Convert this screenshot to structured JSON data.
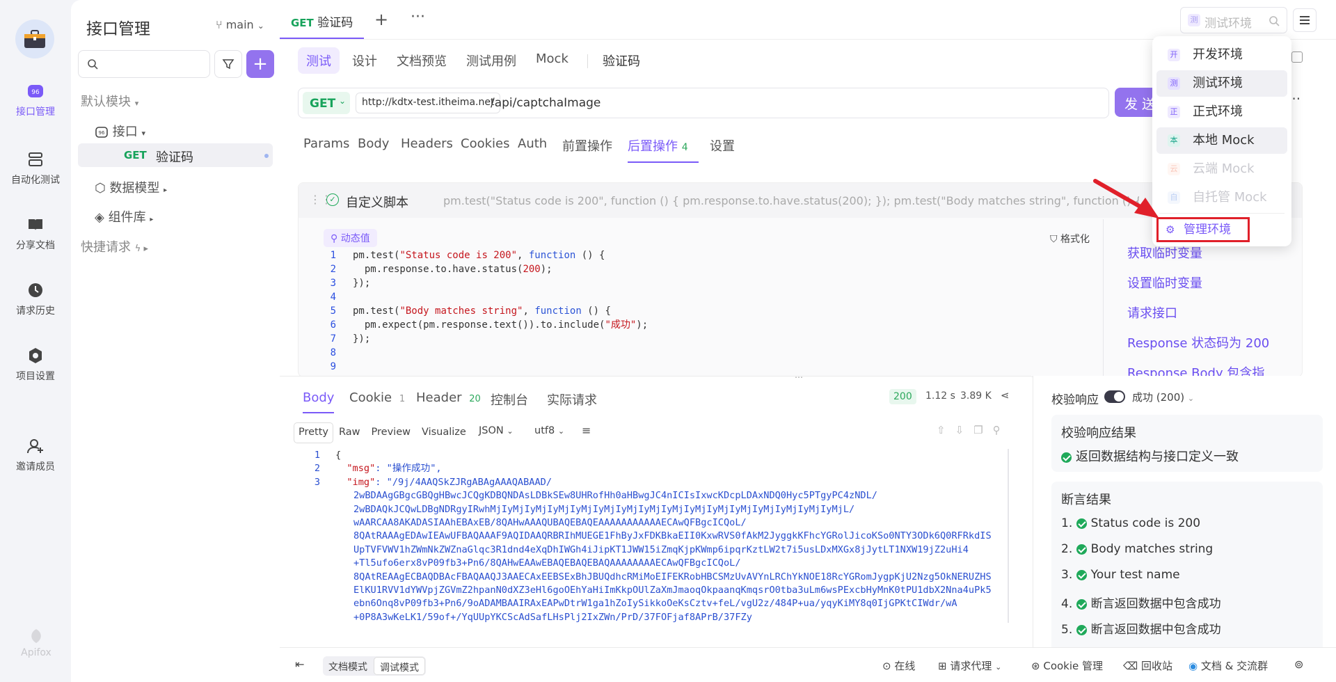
{
  "nav": {
    "items": [
      {
        "label": "接口管理",
        "icon": "api-icon",
        "active": true
      },
      {
        "label": "自动化测试",
        "icon": "automation-icon"
      },
      {
        "label": "分享文档",
        "icon": "book-icon"
      },
      {
        "label": "请求历史",
        "icon": "history-icon"
      },
      {
        "label": "项目设置",
        "icon": "settings-icon"
      },
      {
        "label": "邀请成员",
        "icon": "invite-icon"
      }
    ],
    "brand": "Apifox"
  },
  "tree": {
    "title": "接口管理",
    "branch": "main",
    "default_module": "默认模块",
    "interface": "接口",
    "api_method": "GET",
    "api_name": "验证码",
    "data_model": "数据模型",
    "components": "组件库",
    "quick_request": "快捷请求"
  },
  "top_tab": {
    "method": "GET",
    "name": "验证码"
  },
  "env_select": {
    "env_letter": "测",
    "placeholder": "测试环境"
  },
  "sub_tabs": [
    "测试",
    "设计",
    "文档预览",
    "测试用例",
    "Mock"
  ],
  "sub_title": "验证码",
  "request": {
    "method": "GET",
    "base_url": "http://kdtx-test.itheima.net",
    "path": "/api/captchaImage",
    "send": "发 送"
  },
  "param_tabs": [
    "Params",
    "Body",
    "Headers",
    "Cookies",
    "Auth",
    "前置操作",
    "后置操作",
    "设置"
  ],
  "post_ops_count": "4",
  "script": {
    "title": "自定义脚本",
    "preview": "pm.test(\"Status code is 200\", function () { pm.response.to.have.status(200); }); pm.test(\"Body matches string\", function () { pm.exp",
    "dynamic": "动态值",
    "format": "格式化"
  },
  "code_lines": [
    {
      "n": "1",
      "t": "pm.test(\"Status code is 200\", function () {"
    },
    {
      "n": "2",
      "t": "  pm.response.to.have.status(200);"
    },
    {
      "n": "3",
      "t": "});"
    },
    {
      "n": "4",
      "t": ""
    },
    {
      "n": "5",
      "t": "pm.test(\"Body matches string\", function () {"
    },
    {
      "n": "6",
      "t": "  pm.expect(pm.response.text()).to.include(\"成功\");"
    },
    {
      "n": "7",
      "t": "});"
    },
    {
      "n": "8",
      "t": ""
    },
    {
      "n": "9",
      "t": ""
    }
  ],
  "snippets": [
    "获取临时变量",
    "设置临时变量",
    "请求接口",
    "Response 状态码为 200",
    "Response Body 包含指"
  ],
  "response": {
    "tabs": [
      "Body",
      "Cookie",
      "Header",
      "控制台",
      "实际请求"
    ],
    "cookie_count": "1",
    "header_count": "20",
    "status": "200",
    "time": "1.12 s",
    "size": "3.89 K",
    "view_tabs": [
      "Pretty",
      "Raw",
      "Preview",
      "Visualize"
    ],
    "format": "JSON",
    "encoding": "utf8",
    "body_lines": [
      {
        "n": "1",
        "t": "{"
      },
      {
        "n": "2",
        "t": "  \"msg\": \"操作成功\","
      },
      {
        "n": "3",
        "t": "  \"img\": \"/9j/4AAQSkZJRgABAgAAAQABAAD/"
      },
      {
        "n": "",
        "t": "2wBDAAgGBgcGBQgHBwcJCQgKDBQNDAsLDBkSEw8UHRofHh0aHBwgJC4nICIsIxwcKDcpLDAxNDQ0Hyc5PTgyPC4zNDL/"
      },
      {
        "n": "",
        "t": "2wBDAQkJCQwLDBgNDRgyIRwhMjIyMjIyMjIyMjIyMjIyMjIyMjIyMjIyMjIyMjIyMjIyMjIyMjIyMjIyMjIyMjL/"
      },
      {
        "n": "",
        "t": "wAARCAA8AKADASIAAhEBAxEB/8QAHwAAAQUBAQEBAQEAAAAAAAAAAAECAwQFBgcICQoL/"
      },
      {
        "n": "",
        "t": "8QAtRAAAgEDAwIEAwUFBAQAAAF9AQIDAAQRBRIhMUEGE1FhByJxFDKBkaEII0KxwRVS0fAkM2JyggkKFhcYGRolJicoKSo0NTY3ODk6Q0RFRkdIS"
      },
      {
        "n": "",
        "t": "UpTVFVWV1hZWmNkZWZnaGlqc3R1dnd4eXqDhIWGh4iJipKT1JWW15iZmqKjpKWmp6ipqrKztLW2t7i5usLDxMXGx8jJytLT1NXW19jZ2uHi4"
      },
      {
        "n": "",
        "t": "+Tl5ufo6erx8vP09fb3+Pn6/8QAHwEAAwEBAQEBAQEBAQAAAAAAAAECAwQFBgcICQoL/"
      },
      {
        "n": "",
        "t": "8QAtREAAgECBAQDBAcFBAQAAQJ3AAECAxEEBSExBhJBUQdhcRMiMoEIFEKRobHBCSMzUvAVYnLRChYkNOE18RcYGRomJygpKjU2Nzg5OkNERUZHS"
      },
      {
        "n": "",
        "t": "ElKU1RVV1dYWVpjZGVmZ2hpanN0dXZ3eHl6goOEhYaHiImKkpOUlZaXmJmaoqOkpaanqKmqsrO0tba3uLm6wsPExcbHyMnK0tPU1dbX2Nna4uPk5"
      },
      {
        "n": "",
        "t": "ebn6Onq8vP09fb3+Pn6/9oADAMBAAIRAxEAPwDtrW1ga1hZoIySikkoOeKsCztv+feL/vgU2z/484P+ua/yqyKiMY8q0IjGPKtCIWdr/wA"
      },
      {
        "n": "",
        "t": "+0P8A3wKeLK1/59of+/YqUUpYKCScAdSafLHsPlj2IxZWn/PrD/37FOFjaf8APrB/37FZy"
      }
    ]
  },
  "verify": {
    "label": "校验响应",
    "mode": "成功 (200)",
    "result_title": "校验响应结果",
    "result_text": "返回数据结构与接口定义一致",
    "assert_title": "断言结果",
    "asserts": [
      "Status code is 200",
      "Body matches string",
      "Your test name",
      "断言返回数据中包含成功",
      "断言返回数据中包含成功"
    ]
  },
  "status": {
    "doc_mode": "文档模式",
    "debug_mode": "调试模式",
    "online": "在线",
    "proxy": "请求代理",
    "cookie_mgr": "Cookie 管理",
    "recycle": "回收站",
    "community": "文档 & 交流群"
  },
  "env_menu": {
    "items": [
      {
        "e": "开",
        "label": "开发环境",
        "color": "#7a5af8",
        "bg": "#efeaff"
      },
      {
        "e": "测",
        "label": "测试环境",
        "color": "#7a5af8",
        "bg": "#e6e0ff",
        "sel": true
      },
      {
        "e": "正",
        "label": "正式环境",
        "color": "#7a5af8",
        "bg": "#efeaff"
      },
      {
        "e": "本",
        "label": "本地 Mock",
        "color": "#18a48a",
        "bg": "#dff4ef",
        "sel2": true
      },
      {
        "e": "云",
        "label": "云端 Mock",
        "color": "#f7a08a",
        "bg": "#fff1ec",
        "dis": true
      },
      {
        "e": "自",
        "label": "自托管 Mock",
        "color": "#8fb0ee",
        "bg": "#edf2fd",
        "dis": true
      }
    ],
    "manage": "管理环境"
  },
  "colors": {
    "accent": "#7a5af8",
    "success": "#1fa95a",
    "get": "#17a35b",
    "highlight": "#e0202a"
  }
}
